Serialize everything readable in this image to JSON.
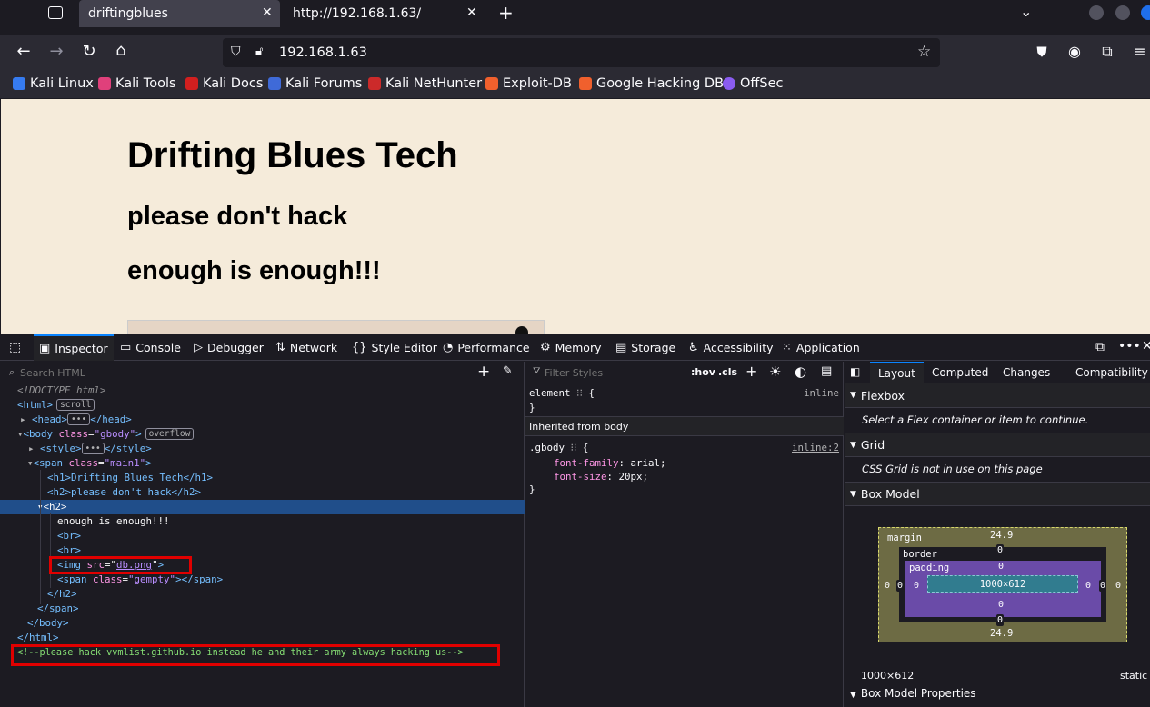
{
  "tabs": [
    {
      "label": "driftingblues",
      "active": true
    },
    {
      "label": "http://192.168.1.63/",
      "active": false
    }
  ],
  "urlbar": {
    "url": "192.168.1.63"
  },
  "bookmarks": [
    {
      "label": "Kali Linux",
      "color": "#367bf0"
    },
    {
      "label": "Kali Tools",
      "color": "#e0407b"
    },
    {
      "label": "Kali Docs",
      "color": "#d21f1f"
    },
    {
      "label": "Kali Forums",
      "color": "#3f6ad8"
    },
    {
      "label": "Kali NetHunter",
      "color": "#cc2a2a"
    },
    {
      "label": "Exploit-DB",
      "color": "#f0602d"
    },
    {
      "label": "Google Hacking DB",
      "color": "#f0602d"
    },
    {
      "label": "OffSec",
      "color": "#8a5cf0"
    }
  ],
  "page": {
    "h1": "Drifting Blues Tech",
    "h2a": "please don't hack",
    "h2b": "enough is enough!!!"
  },
  "devtools": {
    "tabs": [
      "Inspector",
      "Console",
      "Debugger",
      "Network",
      "Style Editor",
      "Performance",
      "Memory",
      "Storage",
      "Accessibility",
      "Application"
    ],
    "search_placeholder": "Search HTML",
    "filter_placeholder": "Filter Styles",
    "hov": ":hov",
    "cls": ".cls",
    "layout_tabs": [
      "Layout",
      "Computed",
      "Changes",
      "Compatibility"
    ],
    "tree": {
      "doctype": "<!DOCTYPE html>",
      "html_open": "<html>",
      "scroll_badge": "scroll",
      "head_open": "<head>",
      "head_close": "</head>",
      "body_open_a": "<body ",
      "body_attr": "class",
      "body_val": "\"gbody\"",
      "overflow_badge": "overflow",
      "style_open": "<style>",
      "style_close": "</style>",
      "span_open_a": "<span ",
      "span_attr": "class",
      "span_val": "\"main1\"",
      "h1_line": "<h1>Drifting Blues Tech</h1>",
      "h2_line": "<h2>please don't hack</h2>",
      "h2_open": "<h2>",
      "text_enough": "enough is enough!!!",
      "br1": "<br>",
      "br2": "<br>",
      "img_open": "<img ",
      "img_attr": "src",
      "img_val": "db.png",
      "img_end": ">",
      "span2_open": "<span ",
      "span2_attr": "class",
      "span2_val": "\"gempty\"",
      "span2_close": "></span>",
      "h2_close": "</h2>",
      "span_close": "</span>",
      "body_close": "</body>",
      "html_close": "</html>",
      "comment": "<!--please hack vvmlist.github.io instead he and their army always hacking us-->"
    },
    "rules": {
      "element_selector": "element",
      "element_source": "inline",
      "inherited": "Inherited from body",
      "gbody_selector": ".gbody",
      "gbody_source": "inline:2",
      "prop1": "font-family",
      "val1": "arial",
      "prop2": "font-size",
      "val2": "20px"
    },
    "layout": {
      "flexbox_title": "Flexbox",
      "flexbox_note": "Select a Flex container or item to continue.",
      "grid_title": "Grid",
      "grid_note": "CSS Grid is not in use on this page",
      "boxmodel_title": "Box Model",
      "margin_label": "margin",
      "border_label": "border",
      "padding_label": "padding",
      "margin_top": "24.9",
      "margin_bottom": "24.9",
      "zero": "0",
      "content_size": "1000×612",
      "footer_size": "1000×612",
      "position": "static",
      "props_title": "Box Model Properties"
    }
  }
}
